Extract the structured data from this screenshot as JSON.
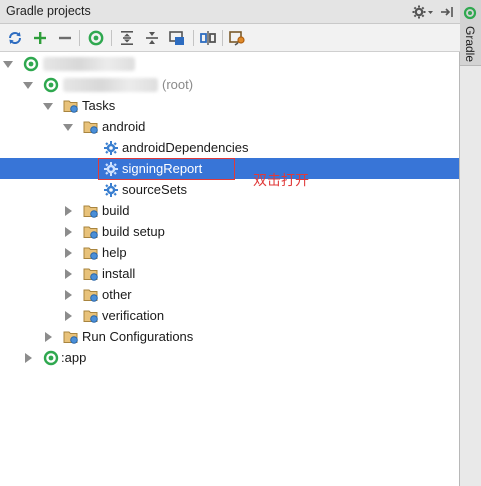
{
  "panel": {
    "title": "Gradle projects"
  },
  "side_tab": {
    "label": "Gradle"
  },
  "toolbar": {
    "buttons": [
      {
        "name": "refresh-icon"
      },
      {
        "name": "add-icon"
      },
      {
        "name": "remove-icon"
      },
      {
        "name": "gradle-execute-icon"
      },
      {
        "name": "expand-all-icon"
      },
      {
        "name": "collapse-all-icon"
      },
      {
        "name": "group-tasks-icon"
      },
      {
        "name": "link-project-icon"
      },
      {
        "name": "settings-icon"
      }
    ]
  },
  "tree": {
    "root_suffix": "(root)",
    "tasks": "Tasks",
    "android": "android",
    "android_dependencies": "androidDependencies",
    "signing_report": "signingReport",
    "source_sets": "sourceSets",
    "build": "build",
    "build_setup": "build setup",
    "help": "help",
    "install": "install",
    "other": "other",
    "verification": "verification",
    "run_configurations": "Run Configurations",
    "app": ":app"
  },
  "annotation": {
    "text": "双击打开"
  },
  "colors": {
    "selection": "#3875d7",
    "annotation": "#e03a3a",
    "gradle_green": "#2fa84f"
  }
}
